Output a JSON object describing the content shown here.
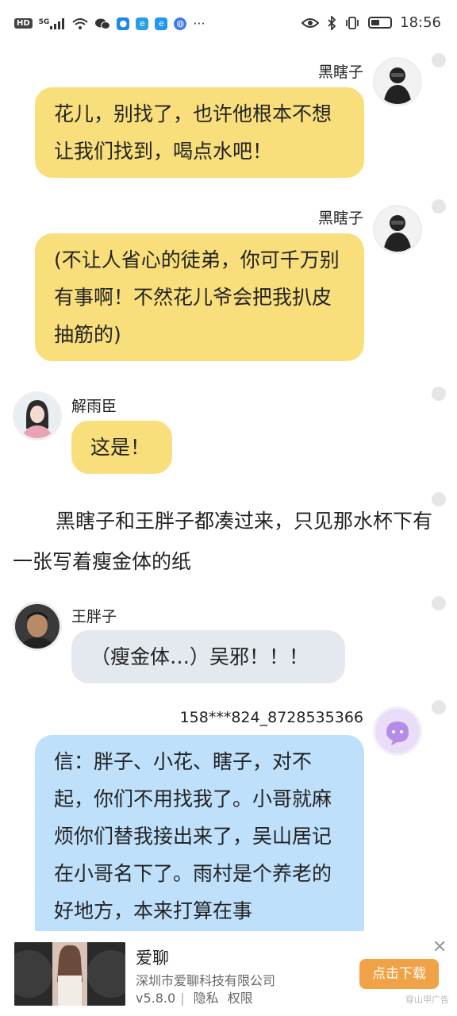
{
  "status_bar": {
    "network_hd": "HD",
    "network_5g": "5G",
    "time": "18:56",
    "battery_level": 0.45,
    "left_icons": [
      "hd-icon",
      "5g-signal-icon",
      "wifi-icon",
      "wechat-icon",
      "shield-app-icon",
      "app-e-icon",
      "app-e2-icon",
      "browser-icon",
      "more-dots-icon"
    ],
    "right_icons": [
      "eye-icon",
      "bluetooth-icon",
      "vibrate-icon",
      "battery-icon"
    ]
  },
  "colors": {
    "bubble_yellow": "#f8df7c",
    "bubble_gray": "#e4e8ef",
    "bubble_blue": "#bfe0fb",
    "download_button": "#f0a247"
  },
  "messages": [
    {
      "sender": "黑瞎子",
      "side": "right",
      "color": "yellow",
      "avatar": "man-in-black-avatar",
      "text": "花儿，别找了，也许他根本不想让我们找到，喝点水吧！"
    },
    {
      "sender": "黑瞎子",
      "side": "right",
      "color": "yellow",
      "avatar": "man-in-black-avatar",
      "text": "(不让人省心的徒弟，你可千万别有事啊！不然花儿爷会把我扒皮抽筋的)"
    },
    {
      "sender": "解雨臣",
      "side": "left",
      "color": "yellow",
      "avatar": "pink-robed-character-avatar",
      "text": "这是！"
    },
    {
      "narration": "黑瞎子和王胖子都凑过来，只见那水杯下有一张写着瘦金体的纸"
    },
    {
      "sender": "王胖子",
      "side": "left",
      "color": "gray",
      "avatar": "man-portrait-avatar",
      "text": "（瘦金体…）吴邪！！！"
    },
    {
      "sender": "158***824_8728535366",
      "side": "right",
      "color": "blue",
      "avatar": "purple-default-avatar",
      "text": "信：胖子、小花、瞎子，对不起，你们不用找我了。小哥就麻烦你们替我接出来了，吴山居记在小哥名下了。雨村是个养老的好地方，本来打算在事"
    }
  ],
  "ad": {
    "title": "爱聊",
    "company": "深圳市爱聊科技有限公司",
    "version": "v5.8.0",
    "privacy": "隐私",
    "permissions": "权限",
    "separator": "|",
    "button": "点击下载",
    "tag": "穿山甲广告",
    "close_icon": "close-icon"
  }
}
